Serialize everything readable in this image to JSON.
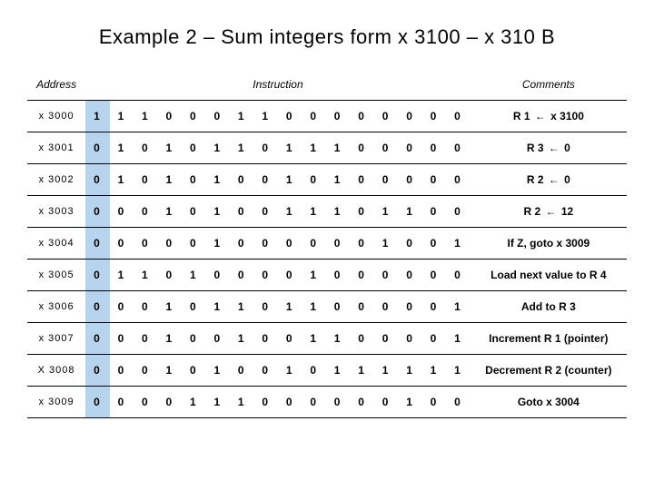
{
  "title": "Example 2 – Sum integers form x 3100 – x 310 B",
  "headers": {
    "address": "Address",
    "instruction": "Instruction",
    "comments": "Comments"
  },
  "arrow": "←",
  "rows": [
    {
      "addr": "x 3000",
      "bits": [
        "1",
        "1",
        "1",
        "0",
        "0",
        "0",
        "1",
        "1",
        "0",
        "0",
        "0",
        "0",
        "0",
        "0",
        "0",
        "0"
      ],
      "comment_pre": "R 1 ",
      "comment_post": " x 3100"
    },
    {
      "addr": "x 3001",
      "bits": [
        "0",
        "1",
        "0",
        "1",
        "0",
        "1",
        "1",
        "0",
        "1",
        "1",
        "1",
        "0",
        "0",
        "0",
        "0",
        "0"
      ],
      "comment_pre": "R 3 ",
      "comment_post": " 0"
    },
    {
      "addr": "x 3002",
      "bits": [
        "0",
        "1",
        "0",
        "1",
        "0",
        "1",
        "0",
        "0",
        "1",
        "0",
        "1",
        "0",
        "0",
        "0",
        "0",
        "0"
      ],
      "comment_pre": "R 2 ",
      "comment_post": " 0"
    },
    {
      "addr": "x 3003",
      "bits": [
        "0",
        "0",
        "0",
        "1",
        "0",
        "1",
        "0",
        "0",
        "1",
        "1",
        "1",
        "0",
        "1",
        "1",
        "0",
        "0"
      ],
      "comment_pre": "R 2 ",
      "comment_post": " 12"
    },
    {
      "addr": "x 3004",
      "bits": [
        "0",
        "0",
        "0",
        "0",
        "0",
        "1",
        "0",
        "0",
        "0",
        "0",
        "0",
        "0",
        "1",
        "0",
        "0",
        "1"
      ],
      "comment_plain": "If Z, goto x 3009"
    },
    {
      "addr": "x 3005",
      "bits": [
        "0",
        "1",
        "1",
        "0",
        "1",
        "0",
        "0",
        "0",
        "0",
        "1",
        "0",
        "0",
        "0",
        "0",
        "0",
        "0"
      ],
      "comment_plain": "Load next value to R 4"
    },
    {
      "addr": "x 3006",
      "bits": [
        "0",
        "0",
        "0",
        "1",
        "0",
        "1",
        "1",
        "0",
        "1",
        "1",
        "0",
        "0",
        "0",
        "0",
        "0",
        "1"
      ],
      "comment_plain": "Add to R 3"
    },
    {
      "addr": "x 3007",
      "bits": [
        "0",
        "0",
        "0",
        "1",
        "0",
        "0",
        "1",
        "0",
        "0",
        "1",
        "1",
        "0",
        "0",
        "0",
        "0",
        "1"
      ],
      "comment_plain": "Increment R 1 (pointer)"
    },
    {
      "addr": "X 3008",
      "bits": [
        "0",
        "0",
        "0",
        "1",
        "0",
        "1",
        "0",
        "0",
        "1",
        "0",
        "1",
        "1",
        "1",
        "1",
        "1",
        "1"
      ],
      "comment_plain": "Decrement R 2 (counter)"
    },
    {
      "addr": "x 3009",
      "bits": [
        "0",
        "0",
        "0",
        "0",
        "1",
        "1",
        "1",
        "0",
        "0",
        "0",
        "0",
        "0",
        "0",
        "1",
        "0",
        "0"
      ],
      "comment_plain": "Goto x 3004"
    }
  ]
}
